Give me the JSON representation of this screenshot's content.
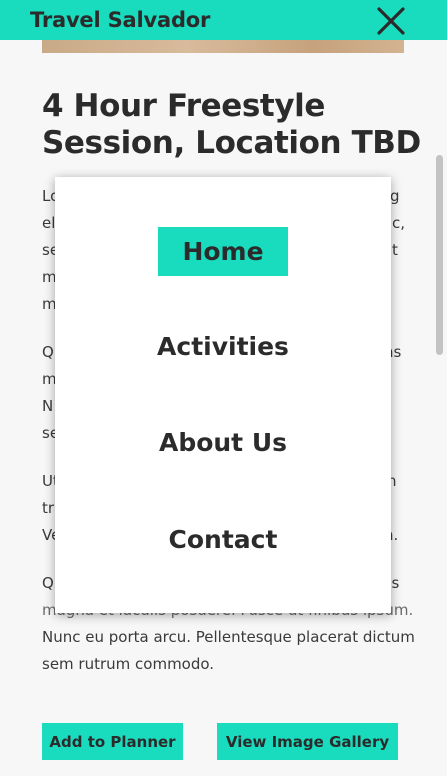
{
  "header": {
    "brand": "Travel Salvador",
    "close_icon": "close-icon"
  },
  "article": {
    "title": "4 Hour Freestyle Session, Location TBD",
    "paragraphs": [
      [
        "Lo",
        "g",
        "el",
        "c,",
        "se",
        "t",
        "m",
        "m"
      ],
      [
        "Q",
        "ns",
        "m",
        "N",
        "se"
      ],
      [
        "Ut",
        "n",
        "tr",
        "Ve",
        "n."
      ],
      [
        "Q",
        "us",
        "magna et iaculis posuere. Fusce ut finibus ipsum.",
        "Nunc eu porta arcu. Pellentesque placerat dictum",
        "sem rutrum commodo."
      ]
    ]
  },
  "menu": {
    "items": [
      {
        "label": "Home",
        "active": true
      },
      {
        "label": "Activities",
        "active": false
      },
      {
        "label": "About Us",
        "active": false
      },
      {
        "label": "Contact",
        "active": false
      }
    ]
  },
  "actions": {
    "add_to_planner": "Add to Planner",
    "view_gallery": "View Image Gallery"
  },
  "colors": {
    "accent": "#19dcbe",
    "text": "#2b2b2b",
    "background": "#f7f7f7"
  }
}
